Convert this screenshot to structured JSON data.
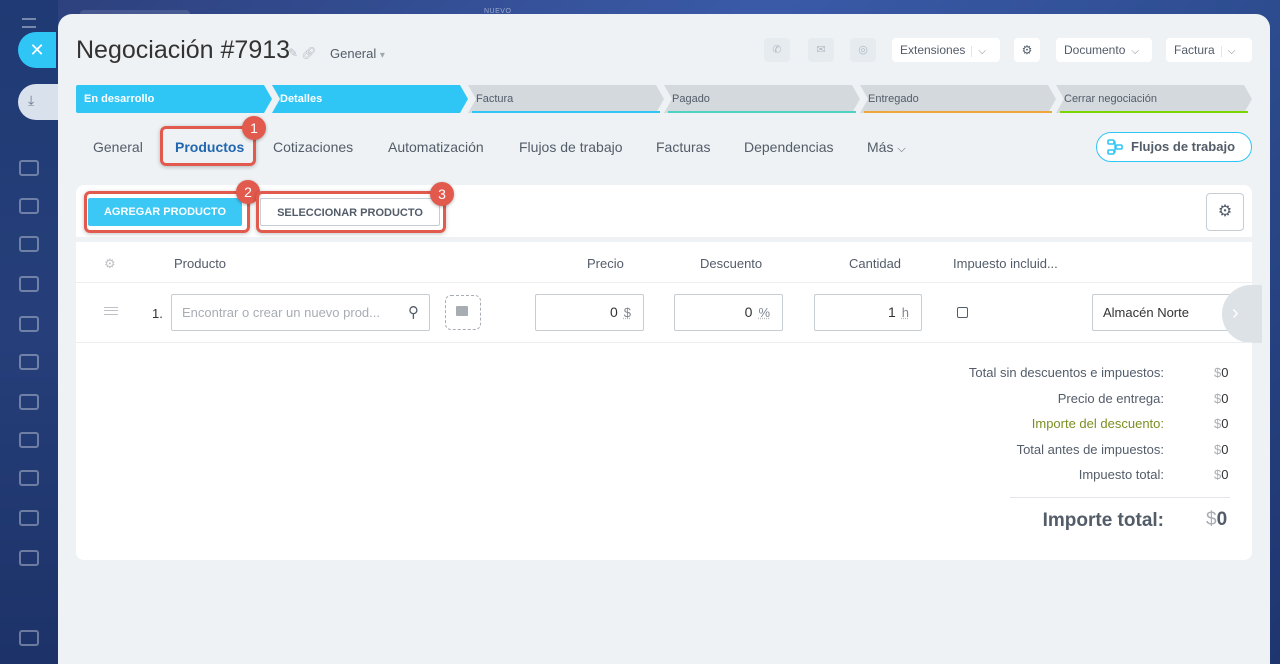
{
  "header": {
    "title": "Negociación #7913",
    "category": "General",
    "extensions_label": "Extensiones",
    "document_label": "Documento",
    "invoice_label": "Factura",
    "top_hint": "NUEVO"
  },
  "stages": [
    {
      "label": "En desarrollo",
      "color": "#2fc6f6",
      "active": true
    },
    {
      "label": "Detalles",
      "color": "#2fc6f6",
      "active": true
    },
    {
      "label": "Factura",
      "color": "#d4d9de",
      "underline": "#2fc6f6",
      "active": false
    },
    {
      "label": "Pagado",
      "color": "#d4d9de",
      "underline": "#4fd2c2",
      "active": false
    },
    {
      "label": "Entregado",
      "color": "#d4d9de",
      "underline": "#f0a63a",
      "active": false
    },
    {
      "label": "Cerrar negociación",
      "color": "#d4d9de",
      "underline": "#7bd500",
      "active": false
    }
  ],
  "tabs": [
    {
      "label": "General",
      "active": false
    },
    {
      "label": "Productos",
      "active": true
    },
    {
      "label": "Cotizaciones",
      "active": false
    },
    {
      "label": "Automatización",
      "active": false
    },
    {
      "label": "Flujos de trabajo",
      "active": false
    },
    {
      "label": "Facturas",
      "active": false
    },
    {
      "label": "Dependencias",
      "active": false
    },
    {
      "label": "Más",
      "active": false
    }
  ],
  "flows_button": "Flujos de trabajo",
  "callouts": [
    "1",
    "2",
    "3"
  ],
  "toolbar": {
    "add_product": "AGREGAR PRODUCTO",
    "select_product": "SELECCIONAR PRODUCTO"
  },
  "table": {
    "headers": {
      "product": "Producto",
      "price": "Precio",
      "discount": "Descuento",
      "quantity": "Cantidad",
      "tax_included": "Impuesto incluid..."
    },
    "rows": [
      {
        "index": "1.",
        "search_placeholder": "Encontrar o crear un nuevo prod...",
        "price": "0",
        "price_unit": "$",
        "discount": "0",
        "discount_unit": "%",
        "quantity": "1",
        "quantity_unit": "h",
        "tax_included": false,
        "store": "Almacén Norte"
      }
    ]
  },
  "totals": {
    "without_discounts_label": "Total sin descuentos e impuestos:",
    "without_discounts_value": "0",
    "delivery_label": "Precio de entrega:",
    "delivery_value": "0",
    "discount_label": "Importe del descuento:",
    "discount_value": "0",
    "before_tax_label": "Total antes de impuestos:",
    "before_tax_value": "0",
    "tax_label": "Impuesto total:",
    "tax_value": "0",
    "grand_label": "Importe total:",
    "grand_value": "0",
    "currency": "$"
  }
}
